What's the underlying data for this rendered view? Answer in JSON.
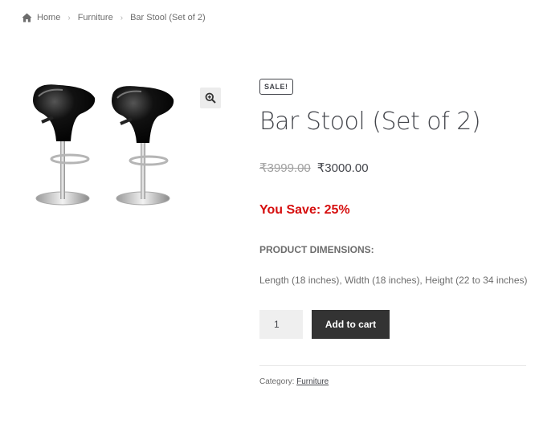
{
  "breadcrumb": {
    "home_icon": "home-icon",
    "items": [
      "Home",
      "Furniture",
      "Bar Stool (Set of 2)"
    ]
  },
  "gallery": {
    "zoom_icon": "zoom-in-icon"
  },
  "product": {
    "sale_badge": "SALE!",
    "title": "Bar Stool (Set of 2)",
    "old_price": "₹3999.00",
    "new_price": "₹3000.00",
    "you_save": "You Save: 25%",
    "dimensions_heading": "PRODUCT DIMENSIONS:",
    "dimensions_text": "Length (18 inches), Width (18 inches), Height (22 to 34 inches)",
    "quantity": "1",
    "add_to_cart_label": "Add to cart",
    "category_label": "Category:",
    "category_value": "Furniture"
  },
  "colors": {
    "you_save": "#d60f0f",
    "button_bg": "#333333",
    "text": "#43454b"
  }
}
